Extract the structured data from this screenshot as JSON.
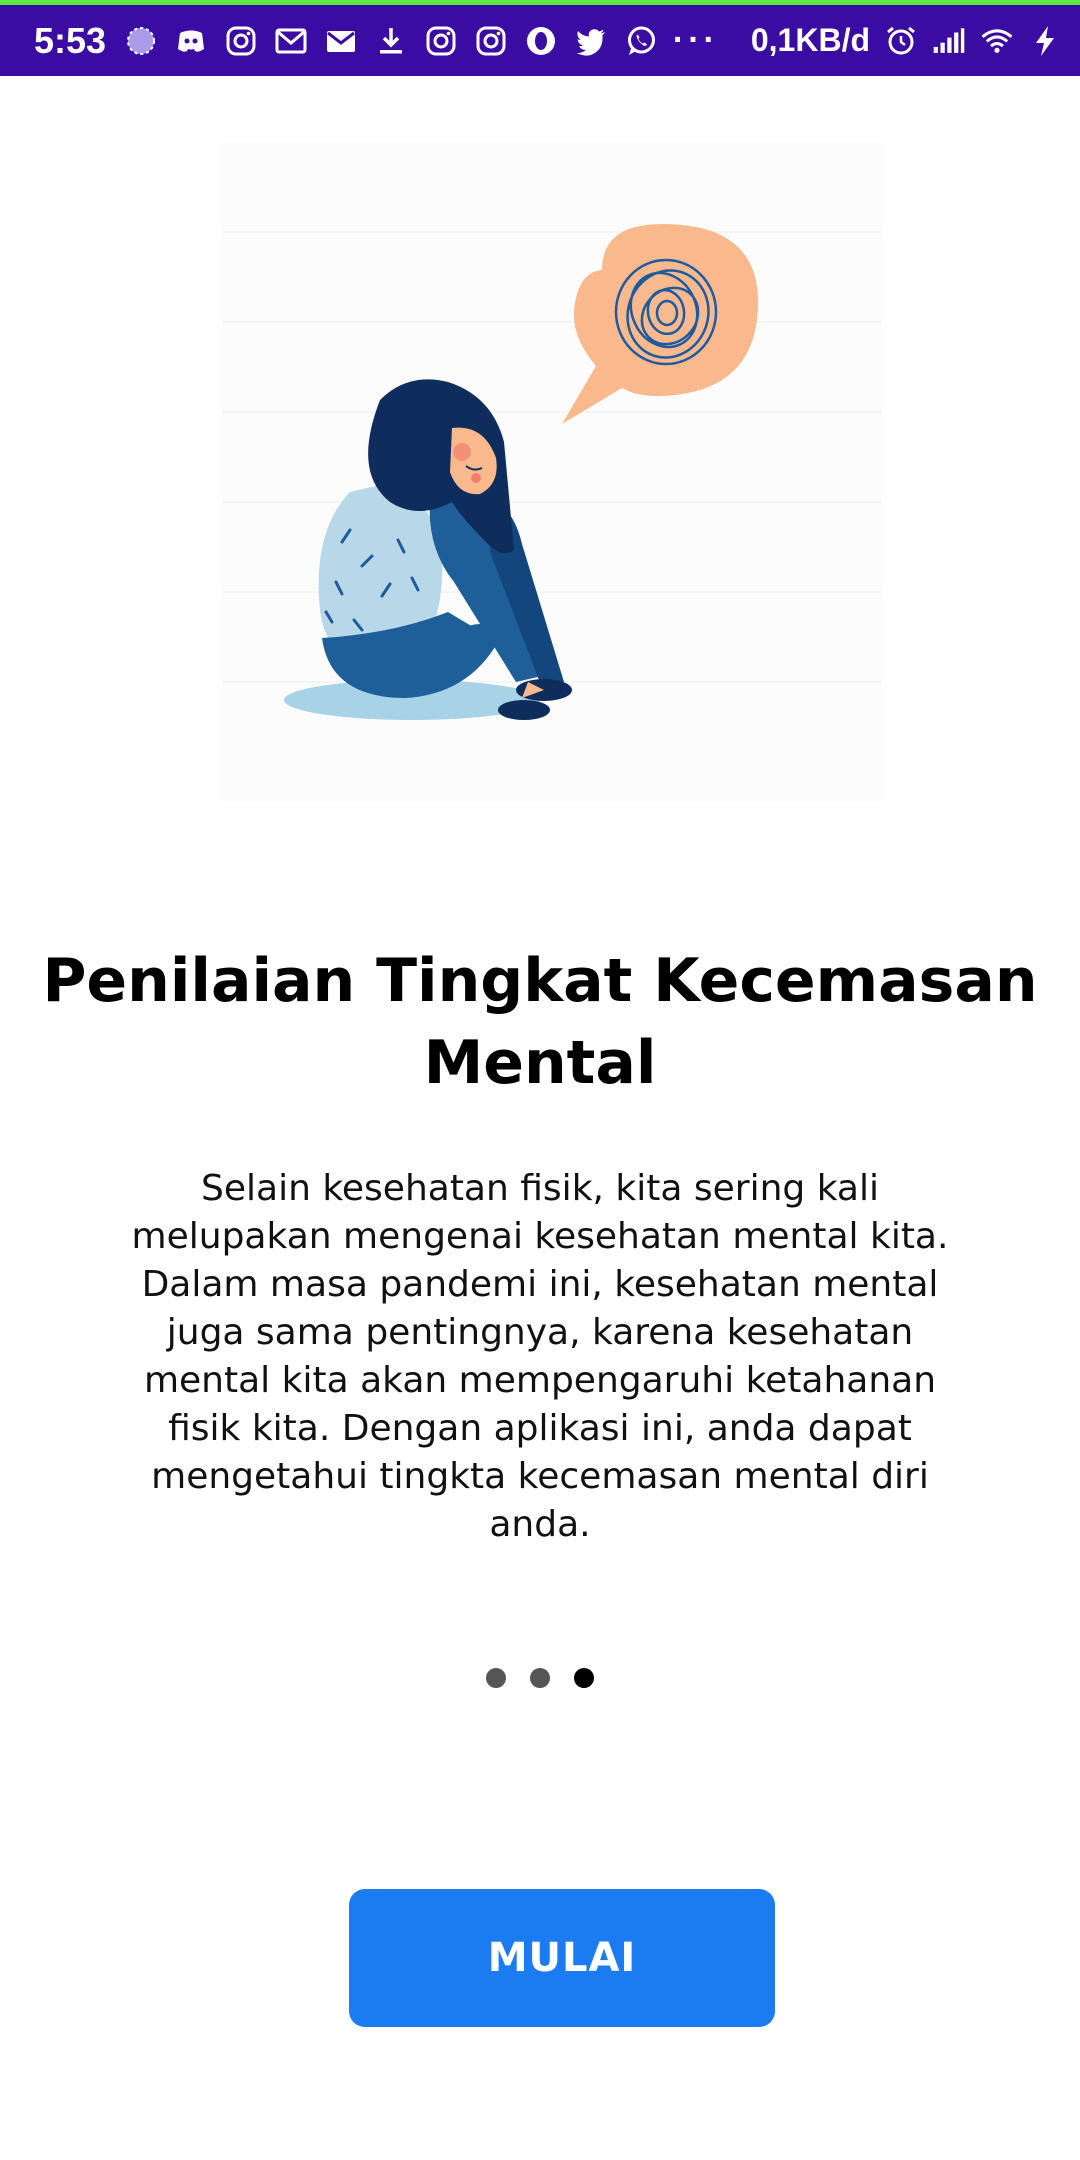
{
  "status_bar": {
    "time": "5:53",
    "net_speed": "0,1KB/d",
    "more": "···",
    "icons": [
      "sync-icon",
      "discord-icon",
      "instagram-icon",
      "gmail-icon",
      "mail-icon",
      "download-icon",
      "instagram-icon",
      "instagram-icon",
      "opera-icon",
      "twitter-icon",
      "whatsapp-icon",
      "alarm-icon",
      "signal-icon",
      "wifi-icon",
      "charging-icon"
    ],
    "background": "#3a0ca3"
  },
  "onboarding": {
    "illustration": "anxious-woman-illustration",
    "title": "Penilaian Tingkat Kecemasan Mental",
    "description": "Selain kesehatan fisik, kita sering kali melupakan mengenai kesehatan mental kita. Dalam masa pandemi ini, kesehatan mental juga sama pentingnya, karena kesehatan mental kita akan mempengaruhi ketahanan fisik kita. Dengan aplikasi ini, anda dapat mengetahui tingkta kecemasan mental diri anda.",
    "page_count": 3,
    "active_page": 3
  },
  "start_button": {
    "label": "MULAI",
    "color": "#1a7cf0"
  }
}
